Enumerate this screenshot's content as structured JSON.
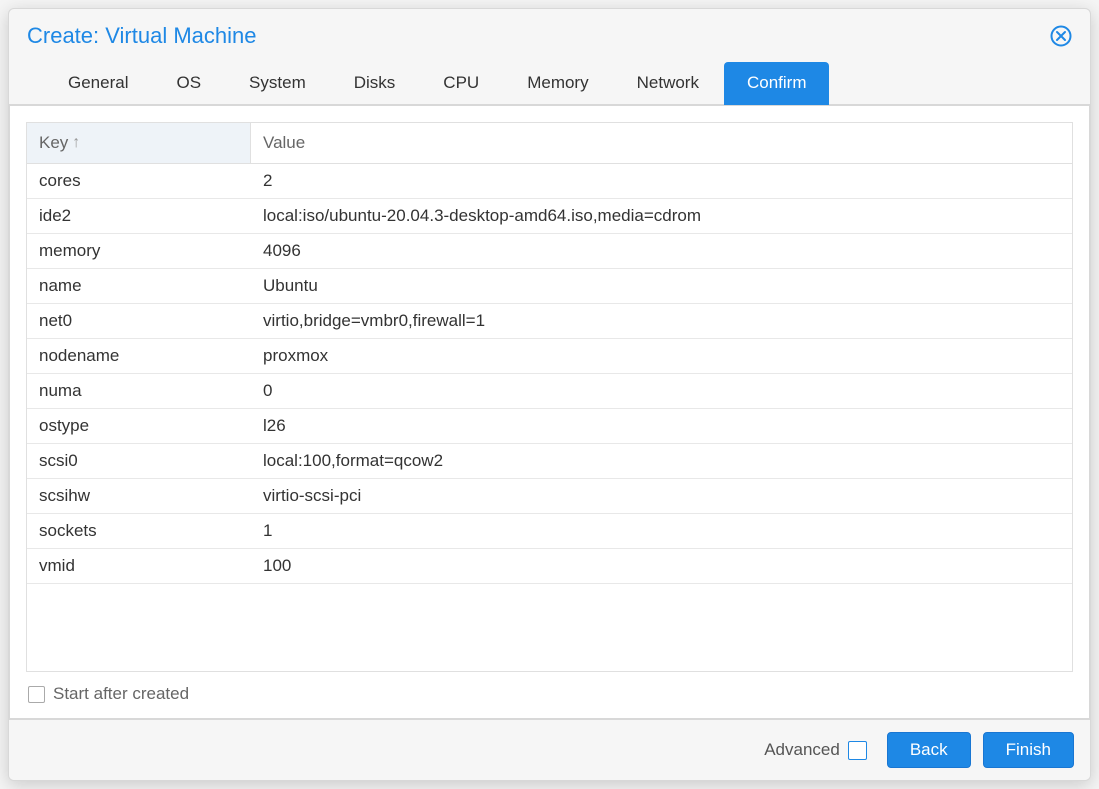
{
  "dialog": {
    "title": "Create: Virtual Machine"
  },
  "tabs": [
    {
      "label": "General",
      "active": false
    },
    {
      "label": "OS",
      "active": false
    },
    {
      "label": "System",
      "active": false
    },
    {
      "label": "Disks",
      "active": false
    },
    {
      "label": "CPU",
      "active": false
    },
    {
      "label": "Memory",
      "active": false
    },
    {
      "label": "Network",
      "active": false
    },
    {
      "label": "Confirm",
      "active": true
    }
  ],
  "table": {
    "columns": {
      "key": "Key",
      "value": "Value",
      "sort": "↑"
    },
    "rows": [
      {
        "key": "cores",
        "value": "2"
      },
      {
        "key": "ide2",
        "value": "local:iso/ubuntu-20.04.3-desktop-amd64.iso,media=cdrom"
      },
      {
        "key": "memory",
        "value": "4096"
      },
      {
        "key": "name",
        "value": "Ubuntu"
      },
      {
        "key": "net0",
        "value": "virtio,bridge=vmbr0,firewall=1"
      },
      {
        "key": "nodename",
        "value": "proxmox"
      },
      {
        "key": "numa",
        "value": "0"
      },
      {
        "key": "ostype",
        "value": "l26"
      },
      {
        "key": "scsi0",
        "value": "local:100,format=qcow2"
      },
      {
        "key": "scsihw",
        "value": "virtio-scsi-pci"
      },
      {
        "key": "sockets",
        "value": "1"
      },
      {
        "key": "vmid",
        "value": "100"
      }
    ]
  },
  "start_after_label": "Start after created",
  "footer": {
    "advanced_label": "Advanced",
    "back_label": "Back",
    "finish_label": "Finish"
  }
}
